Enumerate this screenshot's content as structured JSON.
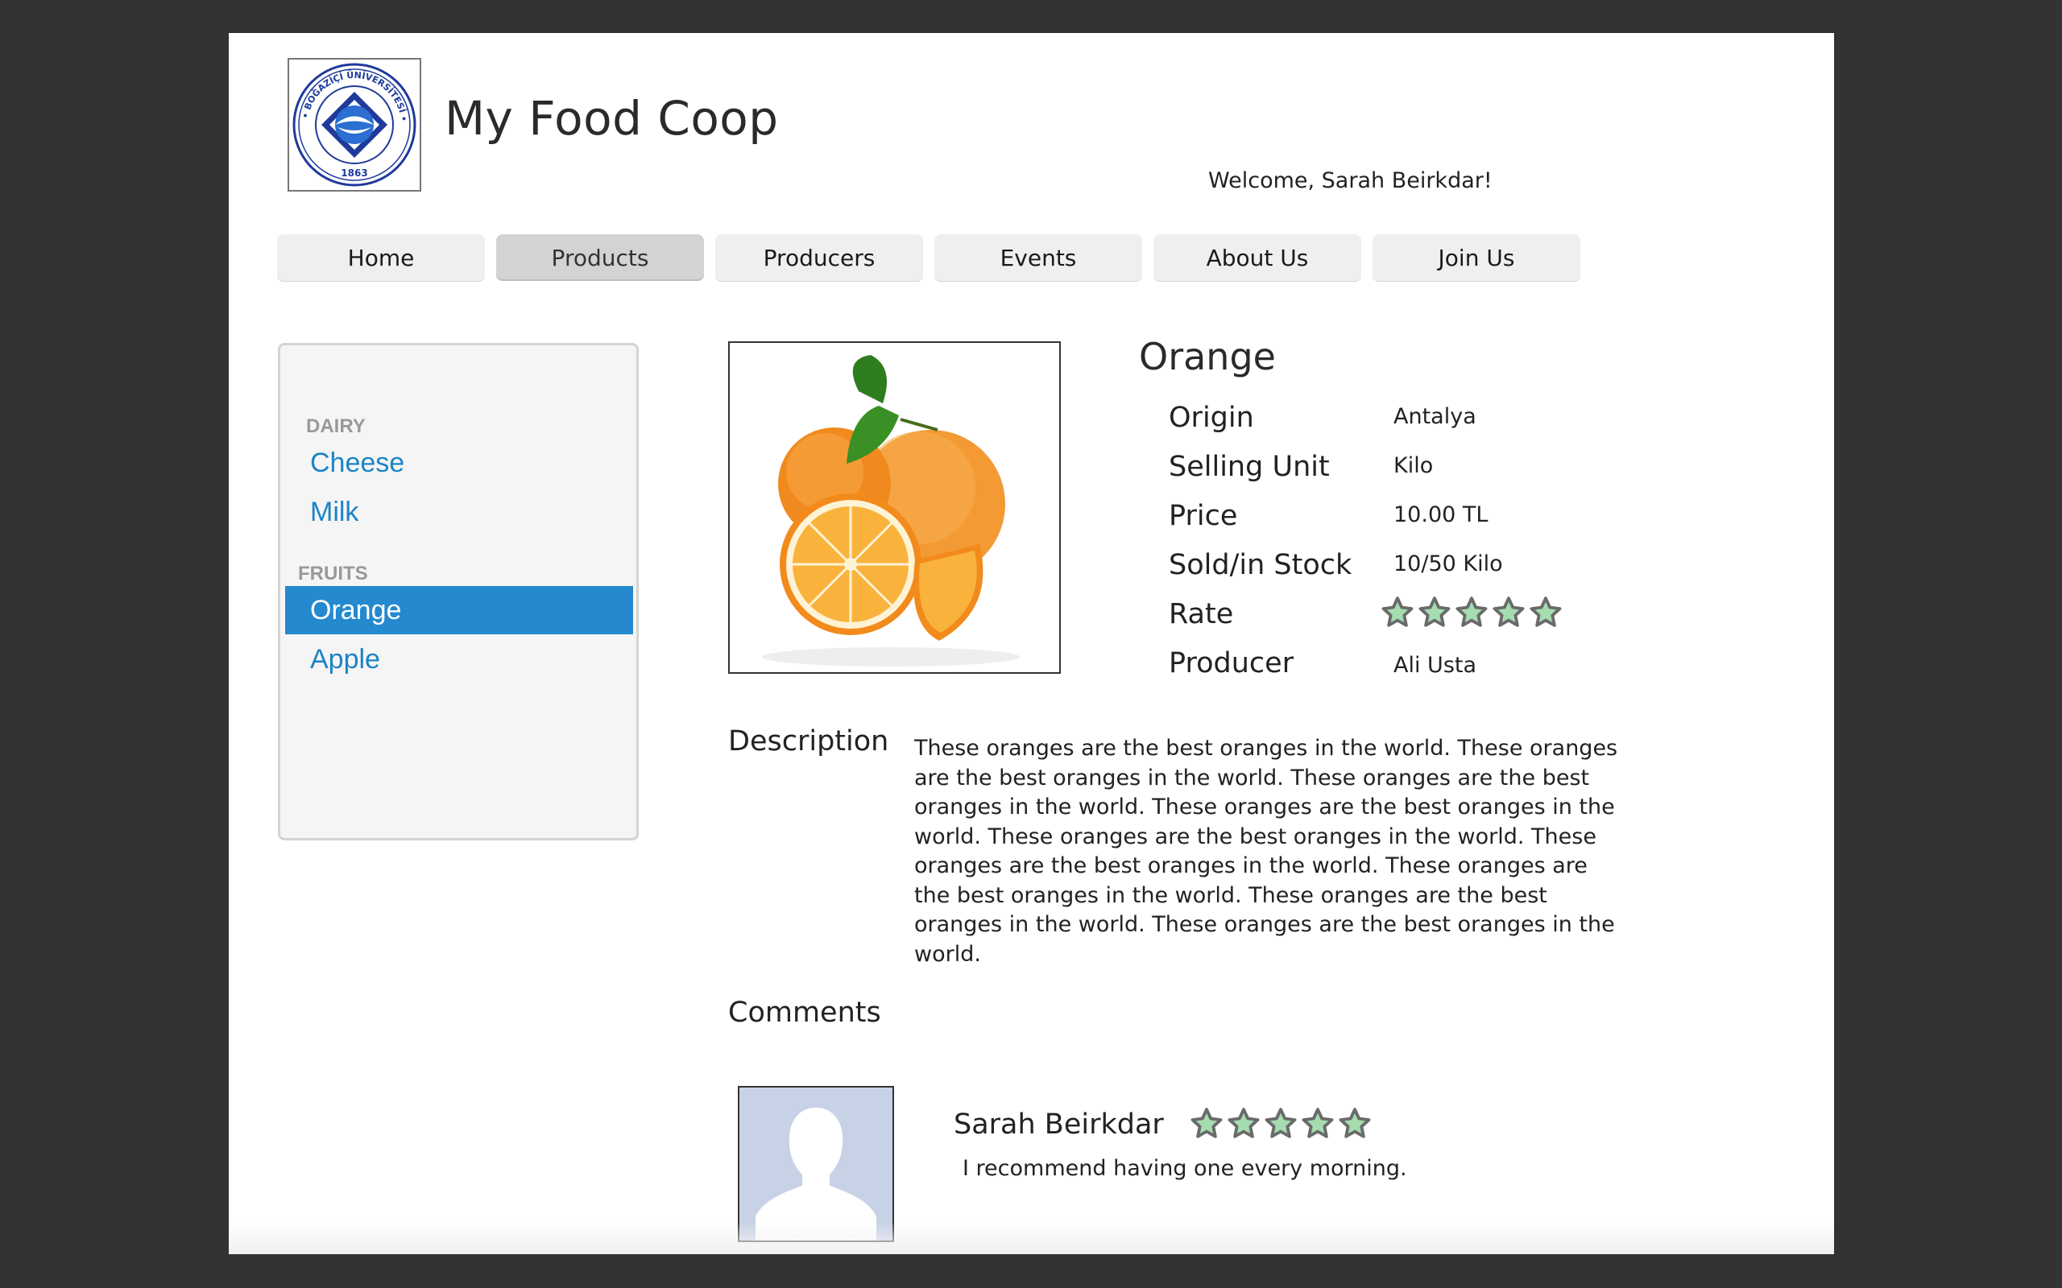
{
  "header": {
    "logo": {
      "name": "university-seal",
      "ring_text": "BOĞAZİÇİ ÜNİVERSİTESİ",
      "year": "1863",
      "color": "#1e3a9a"
    },
    "site_title": "My Food Coop",
    "welcome": "Welcome, Sarah Beirkdar!"
  },
  "nav": [
    {
      "label": "Home",
      "active": false
    },
    {
      "label": "Products",
      "active": true
    },
    {
      "label": "Producers",
      "active": false
    },
    {
      "label": "Events",
      "active": false
    },
    {
      "label": "About Us",
      "active": false
    },
    {
      "label": "Join Us",
      "active": false
    }
  ],
  "sidebar": {
    "categories": [
      {
        "title": "DAIRY",
        "items": [
          {
            "label": "Cheese"
          },
          {
            "label": "Milk"
          }
        ]
      },
      {
        "title": "FRUITS",
        "items": [
          {
            "label": "Orange",
            "active": true
          },
          {
            "label": "Apple"
          }
        ]
      }
    ]
  },
  "product": {
    "name": "Orange",
    "image": "oranges-photo",
    "attributes": {
      "origin": {
        "label": "Origin",
        "value": "Antalya"
      },
      "unit": {
        "label": "Selling Unit",
        "value": "Kilo"
      },
      "price": {
        "label": "Price",
        "value": "10.00 TL"
      },
      "stock": {
        "label": "Sold/in Stock",
        "value": "10/50 Kilo"
      },
      "rate": {
        "label": "Rate",
        "stars_total": 5
      },
      "producer": {
        "label": "Producer",
        "value": "Ali Usta"
      }
    },
    "description_label": "Description",
    "description": "These oranges are the best oranges in the world. These oranges are the best oranges in the world. These oranges are the best oranges in the world. These oranges are the best oranges in the world. These oranges are the best oranges in the world. These oranges are the best oranges in the world. These oranges are the best oranges in the world. These oranges are the best oranges in the world. These oranges are the best oranges in the world."
  },
  "comments": {
    "label": "Comments",
    "items": [
      {
        "author": "Sarah Beirkdar",
        "stars_total": 5,
        "text": "I recommend having one every morning."
      }
    ]
  },
  "colors": {
    "accent": "#2489cf",
    "link": "#1b84c6",
    "star_fill": "#a5dcb0",
    "star_stroke": "#6a6a6a",
    "nav_bg": "#efefef",
    "nav_active_bg": "#d3d3d3"
  }
}
